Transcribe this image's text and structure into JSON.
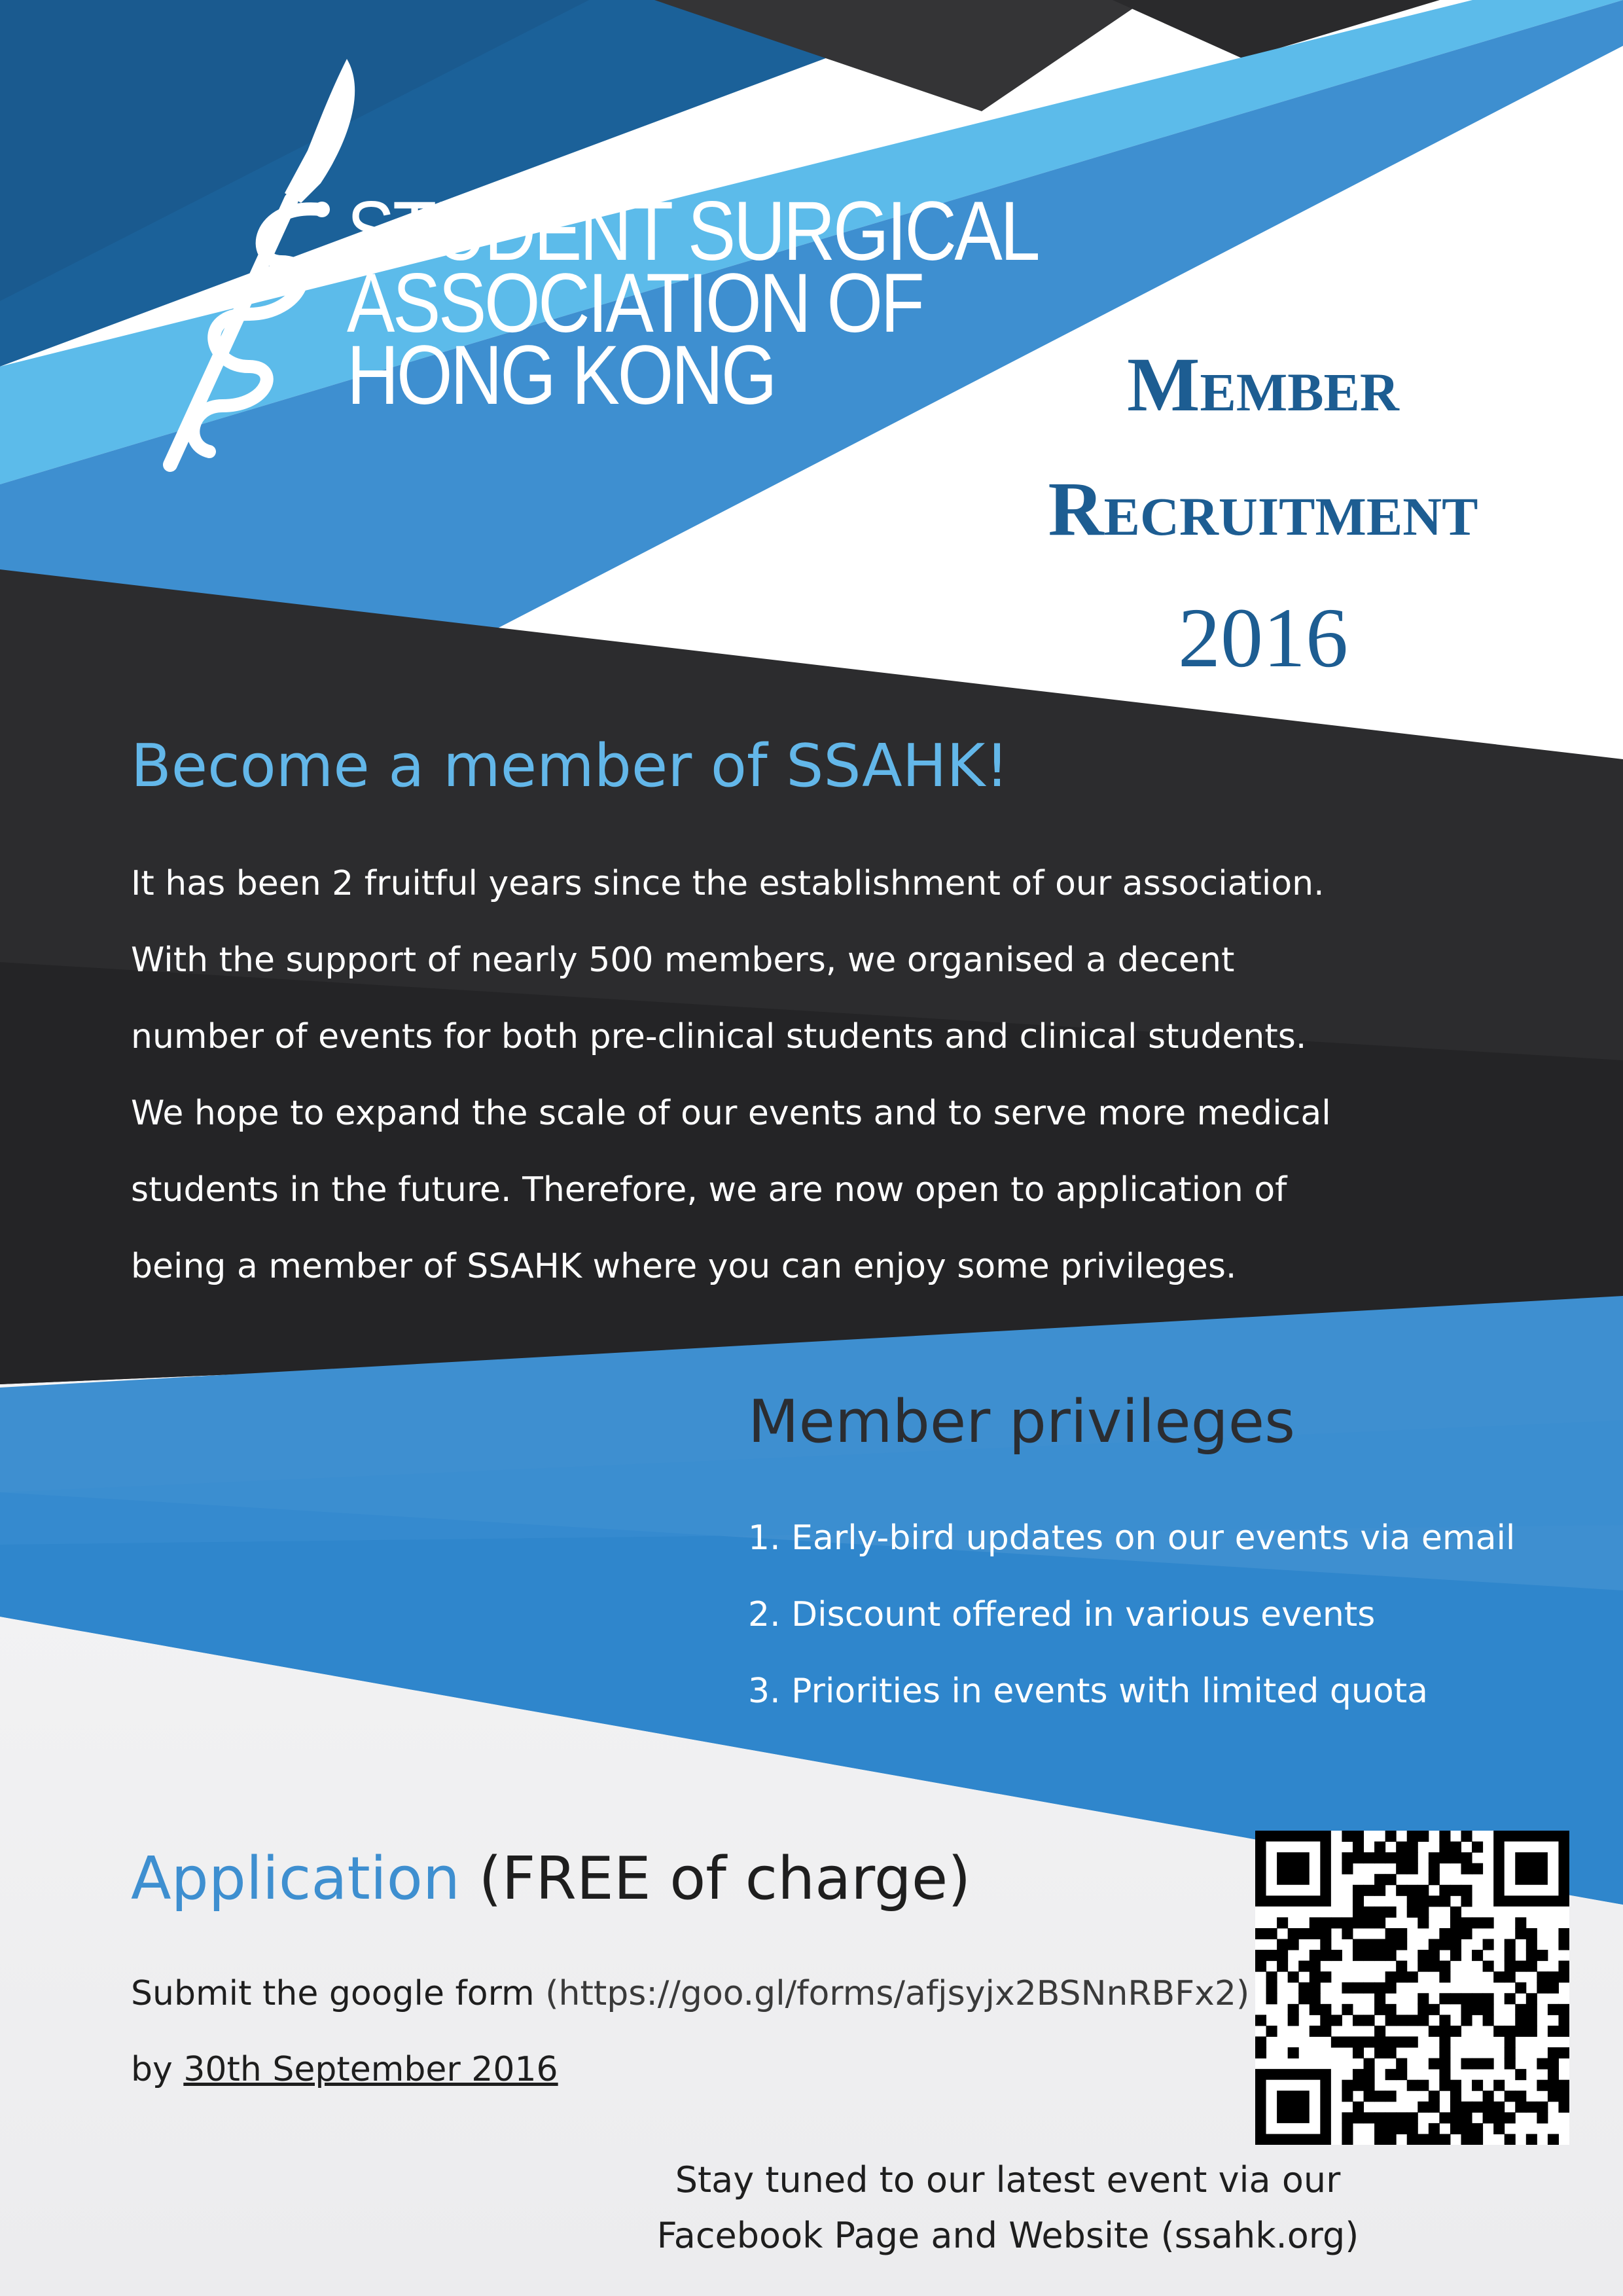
{
  "logo": {
    "icon": "scalpel-serpent-icon",
    "lines": [
      "STUDENT SURGICAL",
      "ASSOCIATION OF",
      "HONG KONG"
    ]
  },
  "title": {
    "line1": "Member",
    "line2": "Recruitment",
    "year": "2016"
  },
  "intro": {
    "heading": "Become a member of SSAHK!",
    "lines": [
      "It has been 2 fruitful years since the establishment of our association.",
      "With the support of nearly 500 members, we organised a decent",
      "number of events for both pre-clinical students and clinical students.",
      "We hope to expand the scale of our events and to serve more medical",
      "students in the future. Therefore, we are now open to application of",
      "being a member of SSAHK where you can enjoy some privileges."
    ]
  },
  "privileges": {
    "heading": "Member privileges",
    "items": [
      "1. Early-bird updates on our events via email",
      "2. Discount offered in various events",
      "3. Priorities in events with limited quota"
    ]
  },
  "application": {
    "heading_accent": "Application",
    "heading_rest": " (FREE of charge)",
    "line1_text": "Submit the google form ",
    "line1_link": "(https://goo.gl/forms/afjsyjx2BSNnRBFx2)",
    "line2_prefix": "by ",
    "deadline": "30th September 2016"
  },
  "footer": {
    "line1": "Stay tuned to our latest event via our",
    "line2": "Facebook Page and Website (ssahk.org)"
  },
  "qr_code": {
    "icon": "qr-code-icon"
  },
  "colors": {
    "dark_navy": "#1d5d92",
    "mid_blue": "#3e8fd0",
    "light_blue": "#63b7e9",
    "dark_grey": "#2b2b2d",
    "white": "#ffffff"
  }
}
